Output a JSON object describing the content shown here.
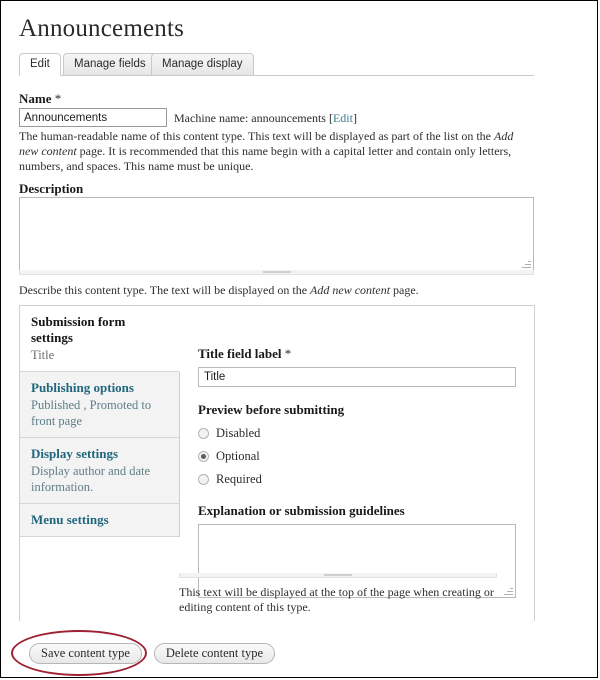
{
  "page": {
    "title": "Announcements"
  },
  "tabs": [
    {
      "label": "Edit",
      "active": true
    },
    {
      "label": "Manage fields",
      "active": false
    },
    {
      "label": "Manage display",
      "active": false
    }
  ],
  "name_field": {
    "label": "Name",
    "required_marker": "*",
    "value": "Announcements",
    "machine_name_prefix": "Machine name: announcements [",
    "machine_name_edit_link": "Edit",
    "machine_name_suffix": "]",
    "help_part1": "The human-readable name of this content type. This text will be displayed as part of the list on the ",
    "help_em1": "Add new content",
    "help_part2": " page. It is recommended that this name begin with a capital letter and contain only letters, numbers, and spaces. This name must be unique."
  },
  "description_field": {
    "label": "Description",
    "value": "",
    "help_part1": "Describe this content type. The text will be displayed on the ",
    "help_em1": "Add new content",
    "help_part2": " page."
  },
  "vertical_tabs": [
    {
      "title": "Submission form settings",
      "summary": "Title",
      "active": true
    },
    {
      "title": "Publishing options",
      "summary": "Published , Promoted to front page",
      "active": false
    },
    {
      "title": "Display settings",
      "summary": "Display author and date information.",
      "active": false
    },
    {
      "title": "Menu settings",
      "summary": "",
      "active": false
    }
  ],
  "submission_form": {
    "title_field_label": "Title field label",
    "title_field_required": "*",
    "title_field_value": "Title",
    "preview_heading": "Preview before submitting",
    "preview_options": [
      {
        "label": "Disabled",
        "selected": false
      },
      {
        "label": "Optional",
        "selected": true
      },
      {
        "label": "Required",
        "selected": false
      }
    ],
    "explanation_heading": "Explanation or submission guidelines",
    "explanation_value": "",
    "explanation_help": "This text will be displayed at the top of the page when creating or editing content of this type."
  },
  "actions": {
    "save_label": "Save content type",
    "delete_label": "Delete content type"
  },
  "annotation": {
    "color": "#9e2233",
    "target": "Save content type"
  }
}
